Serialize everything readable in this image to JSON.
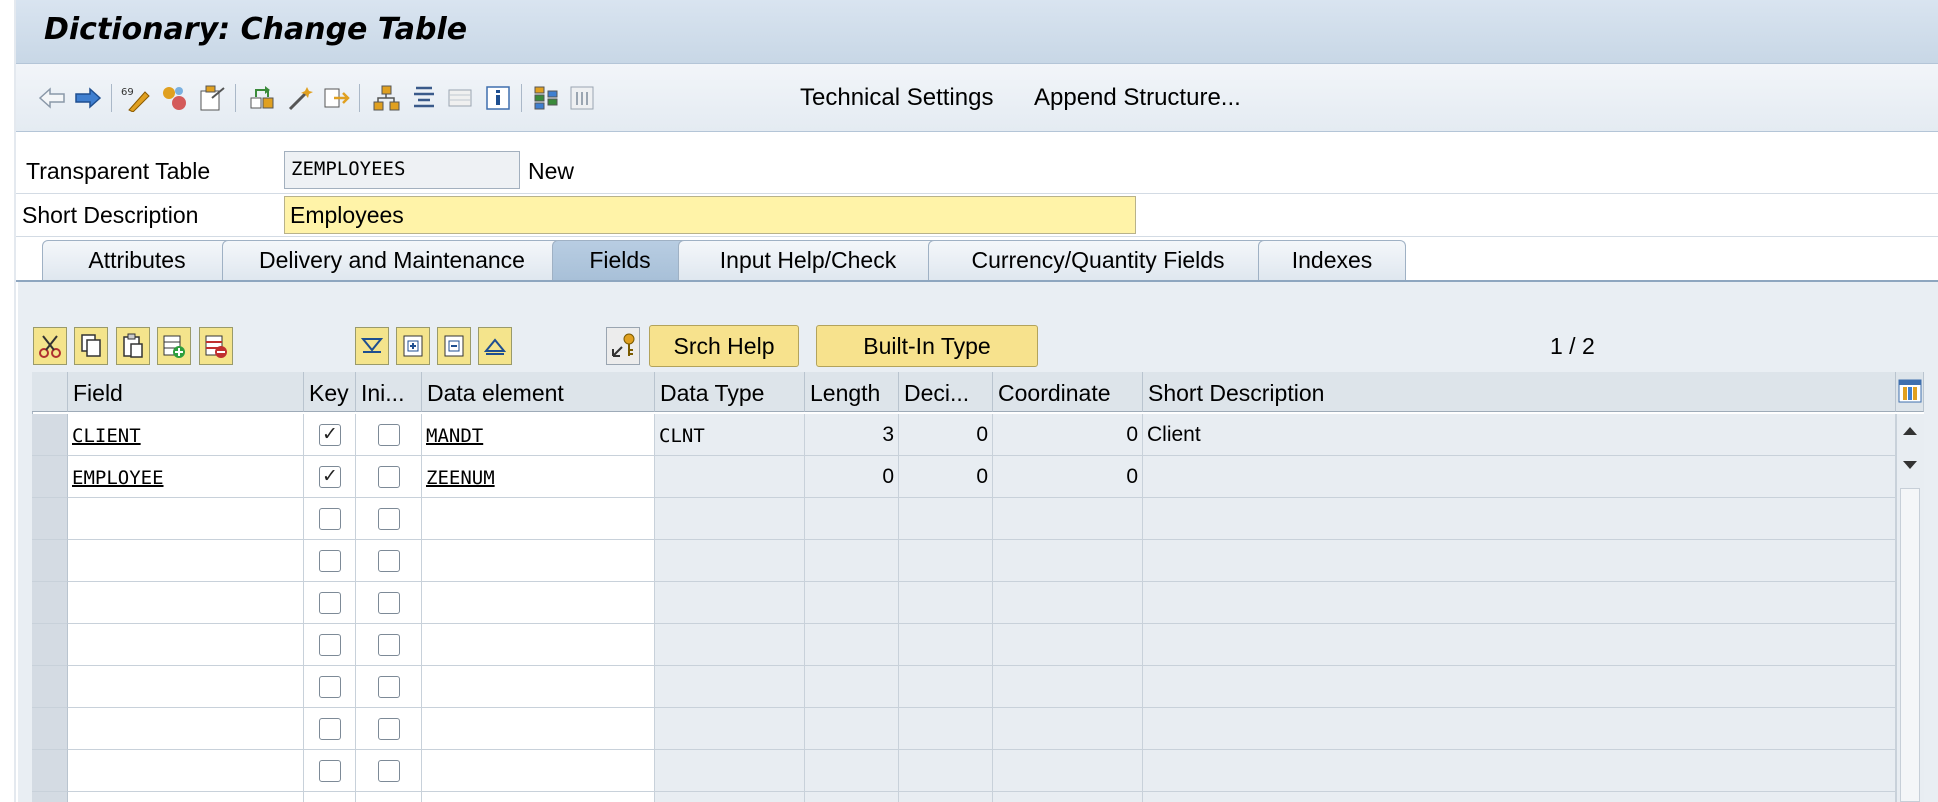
{
  "window": {
    "title": "Dictionary: Change Table"
  },
  "toolbar": {
    "technical_settings": "Technical Settings",
    "append_structure": "Append Structure..."
  },
  "header": {
    "table_label": "Transparent Table",
    "table_value": "ZEMPLOYEES",
    "table_status": "New",
    "desc_label": "Short Description",
    "desc_value": "Employees"
  },
  "tabs": [
    {
      "label": "Attributes"
    },
    {
      "label": "Delivery and Maintenance"
    },
    {
      "label": "Fields",
      "active": true
    },
    {
      "label": "Input Help/Check"
    },
    {
      "label": "Currency/Quantity Fields"
    },
    {
      "label": "Indexes"
    }
  ],
  "table_toolbar": {
    "srch_help": "Srch Help",
    "built_in_type": "Built-In Type",
    "pager": "1 / 2"
  },
  "columns": [
    "Field",
    "Key",
    "Ini...",
    "Data element",
    "Data Type",
    "Length",
    "Deci...",
    "Coordinate",
    "Short Description"
  ],
  "rows": [
    {
      "field": "CLIENT",
      "key": true,
      "ini": false,
      "data_element": "MANDT",
      "data_type": "CLNT",
      "length": "3",
      "decimals": "0",
      "coordinate": "0",
      "short_desc": "Client"
    },
    {
      "field": "EMPLOYEE",
      "key": true,
      "ini": false,
      "data_element": "ZEENUM",
      "data_type": "",
      "length": "0",
      "decimals": "0",
      "coordinate": "0",
      "short_desc": ""
    }
  ],
  "checkbox_checked_glyph": "✓",
  "colors": {
    "title_bg": "#c8d7e6",
    "active_tab": "#a8c0d8",
    "input_yellow": "#fff3a8",
    "button_yellow": "#f7e28d"
  }
}
